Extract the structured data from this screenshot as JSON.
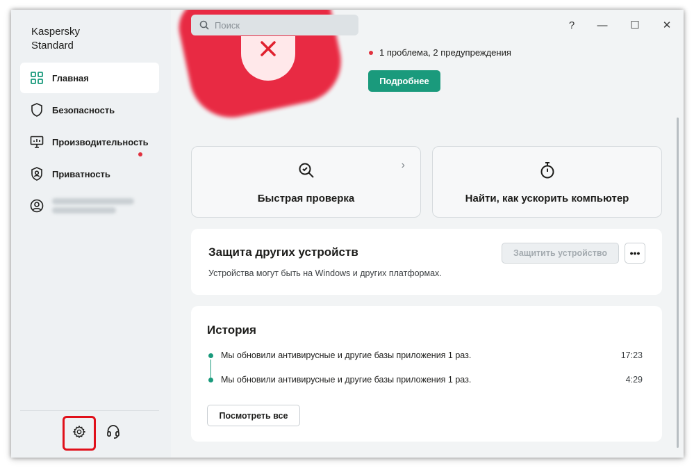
{
  "app": {
    "title_line1": "Kaspersky",
    "title_line2": "Standard"
  },
  "search": {
    "placeholder": "Поиск"
  },
  "window_controls": {
    "help": "?",
    "minimize": "—",
    "maximize": "☐",
    "close": "✕"
  },
  "sidebar": {
    "items": [
      {
        "label": "Главная",
        "icon": "dashboard-icon",
        "active": true
      },
      {
        "label": "Безопасность",
        "icon": "shield-icon"
      },
      {
        "label": "Производительность",
        "icon": "monitor-icon"
      },
      {
        "label": "Приватность",
        "icon": "privacy-shield-icon"
      },
      {
        "label": "",
        "icon": "account-icon",
        "blurred": true
      }
    ],
    "footer": {
      "settings_icon": "gear-icon",
      "support_icon": "headset-icon"
    }
  },
  "hero": {
    "status_text": "1 проблема, 2 предупреждения",
    "details_button": "Подробнее",
    "status_color": "#e0313e"
  },
  "tiles": [
    {
      "label": "Быстрая проверка",
      "icon": "quick-scan-icon"
    },
    {
      "label": "Найти, как ускорить компьютер",
      "icon": "stopwatch-icon"
    }
  ],
  "devices": {
    "title": "Защита других устройств",
    "description": "Устройства могут быть на Windows и других платформах.",
    "protect_button": "Защитить устройство",
    "more_button": "•••"
  },
  "history": {
    "title": "История",
    "items": [
      {
        "text": "Мы обновили антивирусные и другие базы приложения 1 раз.",
        "time": "17:23"
      },
      {
        "text": "Мы обновили антивирусные и другие базы приложения 1 раз.",
        "time": "4:29"
      }
    ],
    "view_all_button": "Посмотреть все"
  },
  "colors": {
    "accent": "#1a9a7c",
    "alert": "#e0313e",
    "highlight": "#e0101a"
  }
}
